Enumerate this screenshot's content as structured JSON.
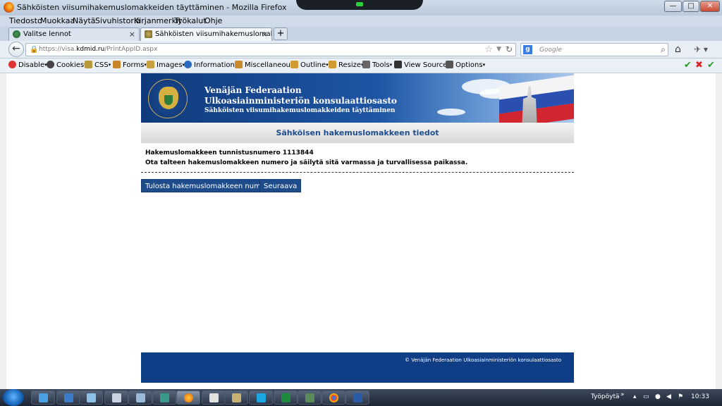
{
  "window": {
    "title": "Sähköisten viisumihakemuslomakkeiden täyttäminen - Mozilla Firefox",
    "controls": {
      "minimize": "—",
      "maximize": "□",
      "close": "✕"
    }
  },
  "menubar": [
    "Tiedosto",
    "Muokkaa",
    "Näytä",
    "Sivuhistoria",
    "Kirjanmerkit",
    "Työkalut",
    "Ohje"
  ],
  "tabs": [
    {
      "label": "Valitse lennot",
      "close": "×",
      "active": false
    },
    {
      "label": "Sähköisten viisumihakemuslomakkei...",
      "close": "×",
      "active": true
    }
  ],
  "newtab": "+",
  "navbar": {
    "back": "←",
    "url_prefix": "https://visa.",
    "url_domain": "kdmid.ru",
    "url_path": "/PrintAppID.aspx",
    "search_placeholder": "Google",
    "search_engine": "g"
  },
  "devbar": {
    "items": [
      "Disable",
      "Cookies",
      "CSS",
      "Forms",
      "Images",
      "Information",
      "Miscellaneous",
      "Outline",
      "Resize",
      "Tools",
      "View Source",
      "Options"
    ],
    "status_icons": [
      "✔",
      "✖",
      "✔"
    ]
  },
  "page": {
    "banner_line1": "Venäjän Federaation",
    "banner_line2": "Ulkoasiainministeriön konsulaattiosasto",
    "banner_line3": "Sähköisten viisumihakemuslomakkeiden täyttäminen",
    "heading": "Sähköisen hakemuslomakkeen tiedot",
    "id_line": "Hakemuslomakkeen tunnistusnumero 1113844",
    "instruction": "Ota talteen hakemuslomakkeen numero ja säilytä sitä varmassa ja turvallisessa paikassa.",
    "print_button": "Tulosta hakemuslomakkeen numero",
    "next_button": "Seuraava",
    "footer": "© Venäjän Federaation Ulkoasiainministeriön konsulaattiosasto"
  },
  "taskbar": {
    "desktop_label": "Työpöytä",
    "expand": "»",
    "time": "10:33"
  },
  "colors": {
    "banner_blue": "#1f56a4",
    "button_blue": "#1e4c8a",
    "footer_blue": "#0f3e86",
    "heading_text": "#1f4d8c"
  }
}
